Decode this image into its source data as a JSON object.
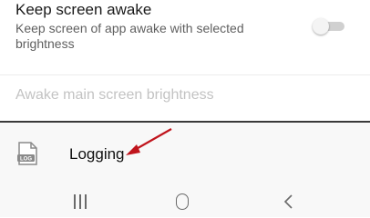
{
  "keep_awake": {
    "title": "Keep screen awake",
    "subtitle": "Keep screen of app awake with selected brightness",
    "toggle_on": false
  },
  "brightness": {
    "label": "Awake main screen brightness",
    "enabled": false
  },
  "logging": {
    "label": "Logging",
    "icon": "log-file-icon",
    "icon_text": "LOG"
  },
  "annotation": {
    "arrow_color": "#c0141c"
  },
  "nav_bar": {
    "recents_icon": "recents-icon",
    "home_icon": "home-icon",
    "back_icon": "back-icon"
  }
}
